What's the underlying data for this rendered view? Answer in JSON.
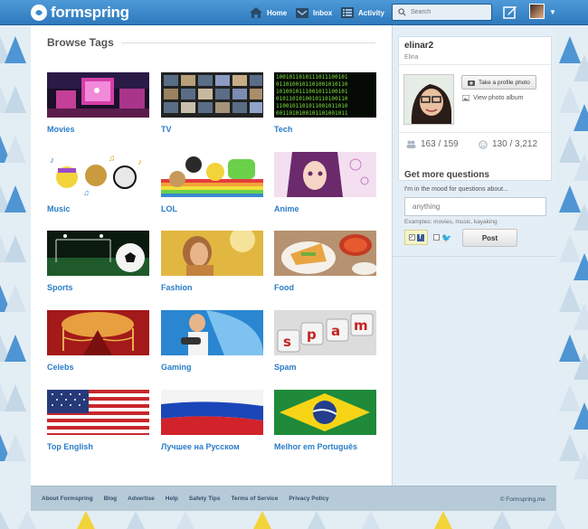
{
  "app": {
    "brand": "formspring",
    "nav": [
      {
        "label": "Home",
        "icon": "home-icon"
      },
      {
        "label": "Inbox",
        "icon": "inbox-icon"
      },
      {
        "label": "Activity",
        "icon": "activity-icon"
      }
    ],
    "search_placeholder": "Search",
    "accent": "#2a7cc7"
  },
  "main": {
    "title": "Browse Tags",
    "tags": [
      {
        "label": "Movies",
        "icon": "movie-theater-image"
      },
      {
        "label": "TV",
        "icon": "tv-wall-image"
      },
      {
        "label": "Tech",
        "icon": "binary-code-image"
      },
      {
        "label": "Music",
        "icon": "music-characters-image"
      },
      {
        "label": "LOL",
        "icon": "meme-cats-image"
      },
      {
        "label": "Anime",
        "icon": "anime-girl-image"
      },
      {
        "label": "Sports",
        "icon": "soccer-ball-image"
      },
      {
        "label": "Fashion",
        "icon": "fashion-model-image"
      },
      {
        "label": "Food",
        "icon": "food-plate-image"
      },
      {
        "label": "Celebs",
        "icon": "red-carpet-image"
      },
      {
        "label": "Gaming",
        "icon": "gamer-image"
      },
      {
        "label": "Spam",
        "icon": "spam-keys-image"
      },
      {
        "label": "Top English",
        "icon": "usa-flag-image"
      },
      {
        "label": "Лучшее на Русском",
        "icon": "russia-flag-image"
      },
      {
        "label": "Melhor em Português",
        "icon": "brazil-flag-image"
      }
    ]
  },
  "sidebar": {
    "profile": {
      "username": "elinar2",
      "name": "Elina",
      "take_photo": "Take a profile photo",
      "view_album": "View photo album",
      "following": "163 / 159",
      "likes": "130 / 3,212"
    },
    "questions": {
      "title": "Get more questions",
      "subtitle": "I'm in the mood for questions about...",
      "input_value": "anything",
      "examples": "Examples: movies, music, kayaking",
      "post": "Post"
    }
  },
  "footer": {
    "links": [
      "About Formspring",
      "Blog",
      "Advertise",
      "Help",
      "Safety Tips",
      "Terms of Service",
      "Privacy Policy"
    ],
    "copyright": "© Formspring.me"
  }
}
